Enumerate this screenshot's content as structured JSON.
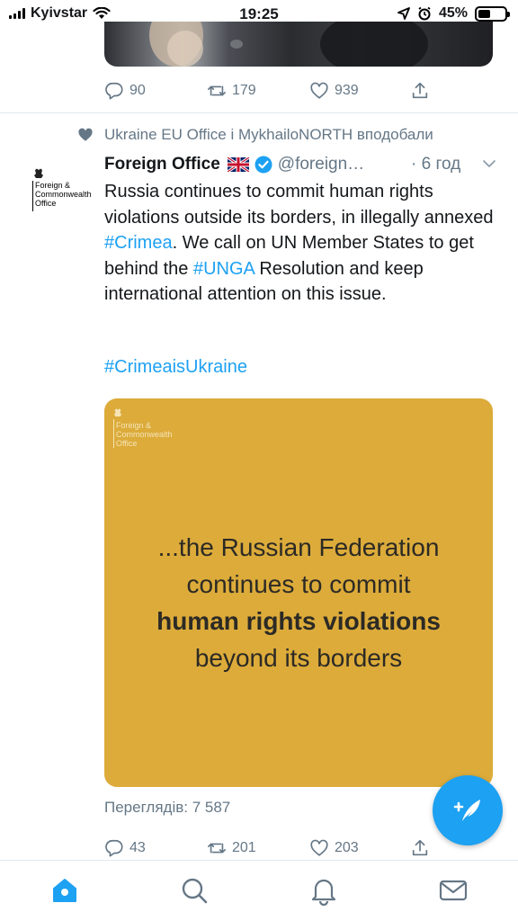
{
  "status_bar": {
    "carrier": "Kyivstar",
    "time": "19:25",
    "battery": "45%",
    "battery_level": 0.45
  },
  "previous_tweet": {
    "reply_count": "90",
    "retweet_count": "179",
    "like_count": "939"
  },
  "social_context": {
    "text": "Ukraine EU Office і MykhailoNORTH вподобали"
  },
  "tweet": {
    "author_name": "Foreign Office",
    "handle": "@foreign…",
    "time": "· 6 год",
    "avatar_text": [
      "Foreign &",
      "Commonwealth",
      "Office"
    ],
    "text_part1": "Russia continues to commit human rights violations outside its borders, in illegally annexed ",
    "hashtag1": "#Crimea",
    "text_part2": ". We call on UN Member States to get behind the ",
    "hashtag2": "#UNGA",
    "text_part3": " Resolution and keep international attention on this issue.",
    "hashtag3": "#CrimeaisUkraine",
    "card": {
      "logo_lines": [
        "Foreign &",
        "Commonwealth",
        "Office"
      ],
      "quote_line1": "...the Russian Federation",
      "quote_line2": "continues to commit",
      "quote_line3": "human rights violations",
      "quote_line4": "beyond its borders",
      "background_color": "#dcab3a"
    },
    "views": "Переглядів: 7 587",
    "reply_count": "43",
    "retweet_count": "201",
    "like_count": "203"
  },
  "tabbar": {
    "items": [
      "home-icon",
      "search-icon",
      "notifications-icon",
      "messages-icon"
    ],
    "active": "home-icon",
    "accent_color": "#1da1f2"
  }
}
